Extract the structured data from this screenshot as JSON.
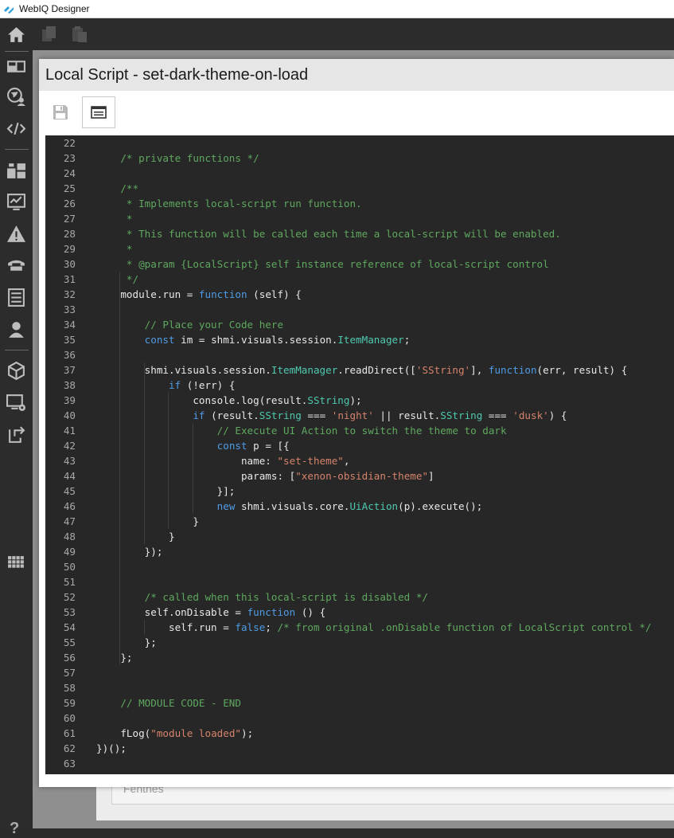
{
  "app": {
    "title": "WebIQ Designer"
  },
  "sidebar": {
    "items": [
      {
        "icon": "home-icon"
      },
      {
        "icon": "layout-icon"
      },
      {
        "icon": "globe-user-icon"
      },
      {
        "icon": "code-icon"
      },
      {
        "icon": "widgets-icon"
      },
      {
        "icon": "monitor-chart-icon"
      },
      {
        "icon": "warning-icon"
      },
      {
        "icon": "phone-icon"
      },
      {
        "icon": "list-icon"
      },
      {
        "icon": "user-icon"
      },
      {
        "icon": "cube-icon"
      },
      {
        "icon": "display-settings-icon"
      },
      {
        "icon": "export-icon"
      },
      {
        "icon": "grid-icon"
      }
    ],
    "help_label": "?"
  },
  "toolbar": {
    "items": [
      {
        "icon": "copy-icon"
      },
      {
        "icon": "paste-icon"
      }
    ]
  },
  "background": {
    "field_text": "Fenthes"
  },
  "dialog": {
    "title": "Local Script - set-dark-theme-on-load",
    "toolbar": {
      "save_icon": "save-icon",
      "properties_icon": "properties-icon"
    }
  },
  "editor": {
    "colors": {
      "background": "#272727",
      "keyword": "#4f9ce6",
      "string": "#d6836b",
      "comment": "#5fa85f",
      "type": "#4ec9b0",
      "text": "#e8e8e8"
    },
    "lines": [
      {
        "n": "22",
        "tokens": []
      },
      {
        "n": "23",
        "tokens": [
          [
            "c",
            "    /* private functions */"
          ]
        ]
      },
      {
        "n": "24",
        "tokens": []
      },
      {
        "n": "25",
        "tokens": [
          [
            "c",
            "    /**"
          ]
        ]
      },
      {
        "n": "26",
        "tokens": [
          [
            "c",
            "     * Implements local-script run function."
          ]
        ]
      },
      {
        "n": "27",
        "tokens": [
          [
            "c",
            "     *"
          ]
        ]
      },
      {
        "n": "28",
        "tokens": [
          [
            "c",
            "     * This function will be called each time a local-script will be enabled."
          ]
        ]
      },
      {
        "n": "29",
        "tokens": [
          [
            "c",
            "     *"
          ]
        ]
      },
      {
        "n": "30",
        "tokens": [
          [
            "c",
            "     * @param {LocalScript} self instance reference of local-script control"
          ]
        ]
      },
      {
        "n": "31",
        "tokens": [
          [
            "c",
            "     */"
          ]
        ]
      },
      {
        "n": "32",
        "tokens": [
          [
            "p",
            "    module.run = "
          ],
          [
            "k",
            "function"
          ],
          [
            "p",
            " (self) {"
          ]
        ]
      },
      {
        "n": "33",
        "tokens": []
      },
      {
        "n": "34",
        "tokens": [
          [
            "c",
            "        // Place your Code here"
          ]
        ]
      },
      {
        "n": "35",
        "tokens": [
          [
            "p",
            "        "
          ],
          [
            "k",
            "const"
          ],
          [
            "p",
            " im = shmi.visuals.session."
          ],
          [
            "y",
            "ItemManager"
          ],
          [
            "p",
            ";"
          ]
        ]
      },
      {
        "n": "36",
        "tokens": []
      },
      {
        "n": "37",
        "tokens": [
          [
            "p",
            "        shmi.visuals.session."
          ],
          [
            "y",
            "ItemManager"
          ],
          [
            "p",
            ".readDirect(["
          ],
          [
            "s",
            "'SString'"
          ],
          [
            "p",
            "], "
          ],
          [
            "k",
            "function"
          ],
          [
            "p",
            "(err, result) {"
          ]
        ]
      },
      {
        "n": "38",
        "tokens": [
          [
            "p",
            "            "
          ],
          [
            "k",
            "if"
          ],
          [
            "p",
            " (!err) {"
          ]
        ]
      },
      {
        "n": "39",
        "tokens": [
          [
            "p",
            "                console.log(result."
          ],
          [
            "y",
            "SString"
          ],
          [
            "p",
            ");"
          ]
        ]
      },
      {
        "n": "40",
        "tokens": [
          [
            "p",
            "                "
          ],
          [
            "k",
            "if"
          ],
          [
            "p",
            " (result."
          ],
          [
            "y",
            "SString"
          ],
          [
            "p",
            " === "
          ],
          [
            "s",
            "'night'"
          ],
          [
            "p",
            " || result."
          ],
          [
            "y",
            "SString"
          ],
          [
            "p",
            " === "
          ],
          [
            "s",
            "'dusk'"
          ],
          [
            "p",
            ") {"
          ]
        ]
      },
      {
        "n": "41",
        "tokens": [
          [
            "c",
            "                    // Execute UI Action to switch the theme to dark"
          ]
        ]
      },
      {
        "n": "42",
        "tokens": [
          [
            "p",
            "                    "
          ],
          [
            "k",
            "const"
          ],
          [
            "p",
            " p = [{"
          ]
        ]
      },
      {
        "n": "43",
        "tokens": [
          [
            "p",
            "                        name: "
          ],
          [
            "s",
            "\"set-theme\""
          ],
          [
            "p",
            ","
          ]
        ]
      },
      {
        "n": "44",
        "tokens": [
          [
            "p",
            "                        params: ["
          ],
          [
            "s",
            "\"xenon-obsidian-theme\""
          ],
          [
            "p",
            "]"
          ]
        ]
      },
      {
        "n": "45",
        "tokens": [
          [
            "p",
            "                    }];"
          ]
        ]
      },
      {
        "n": "46",
        "tokens": [
          [
            "p",
            "                    "
          ],
          [
            "k",
            "new"
          ],
          [
            "p",
            " shmi.visuals.core."
          ],
          [
            "y",
            "UiAction"
          ],
          [
            "p",
            "(p).execute();"
          ]
        ]
      },
      {
        "n": "47",
        "tokens": [
          [
            "p",
            "                }"
          ]
        ]
      },
      {
        "n": "48",
        "tokens": [
          [
            "p",
            "            }"
          ]
        ]
      },
      {
        "n": "49",
        "tokens": [
          [
            "p",
            "        });"
          ]
        ]
      },
      {
        "n": "50",
        "tokens": []
      },
      {
        "n": "51",
        "tokens": []
      },
      {
        "n": "52",
        "tokens": [
          [
            "c",
            "        /* called when this local-script is disabled */"
          ]
        ]
      },
      {
        "n": "53",
        "tokens": [
          [
            "p",
            "        self.onDisable = "
          ],
          [
            "k",
            "function"
          ],
          [
            "p",
            " () {"
          ]
        ]
      },
      {
        "n": "54",
        "tokens": [
          [
            "p",
            "            self.run = "
          ],
          [
            "k",
            "false"
          ],
          [
            "p",
            "; "
          ],
          [
            "c",
            "/* from original .onDisable function of LocalScript control */"
          ]
        ]
      },
      {
        "n": "55",
        "tokens": [
          [
            "p",
            "        };"
          ]
        ]
      },
      {
        "n": "56",
        "tokens": [
          [
            "p",
            "    };"
          ]
        ]
      },
      {
        "n": "57",
        "tokens": []
      },
      {
        "n": "58",
        "tokens": []
      },
      {
        "n": "59",
        "tokens": [
          [
            "c",
            "    // MODULE CODE - END"
          ]
        ]
      },
      {
        "n": "60",
        "tokens": []
      },
      {
        "n": "61",
        "tokens": [
          [
            "p",
            "    fLog("
          ],
          [
            "s",
            "\"module loaded\""
          ],
          [
            "p",
            ");"
          ]
        ]
      },
      {
        "n": "62",
        "tokens": [
          [
            "p",
            "})();"
          ]
        ]
      },
      {
        "n": "63",
        "tokens": []
      }
    ]
  }
}
